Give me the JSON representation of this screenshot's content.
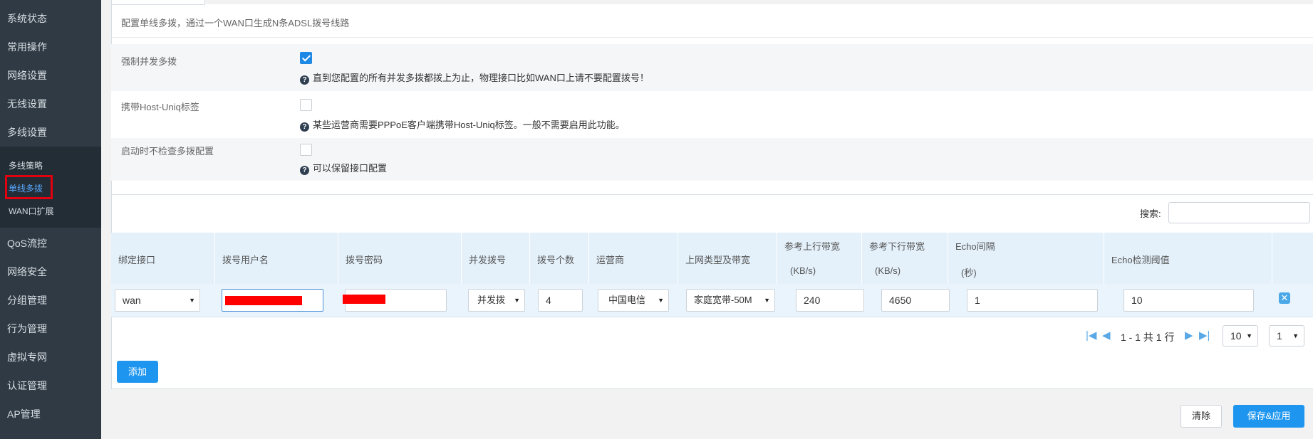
{
  "sidebar": {
    "items": [
      {
        "label": "系统状态"
      },
      {
        "label": "常用操作"
      },
      {
        "label": "网络设置"
      },
      {
        "label": "无线设置"
      },
      {
        "label": "多线设置"
      },
      {
        "label": "QoS流控"
      },
      {
        "label": "网络安全"
      },
      {
        "label": "分组管理"
      },
      {
        "label": "行为管理"
      },
      {
        "label": "虚拟专网"
      },
      {
        "label": "认证管理"
      },
      {
        "label": "AP管理"
      }
    ],
    "submenu": [
      {
        "label": "多线策略",
        "active": false
      },
      {
        "label": "单线多拨",
        "active": true
      },
      {
        "label": "WAN口扩展",
        "active": false
      }
    ]
  },
  "page": {
    "description": "配置单线多拨，通过一个WAN口生成N条ADSL拨号线路"
  },
  "options": [
    {
      "label": "强制并发多拨",
      "checked": true,
      "help": "直到您配置的所有并发多拨都拨上为止，物理接口比如WAN口上请不要配置拨号！"
    },
    {
      "label": "携带Host-Uniq标签",
      "checked": false,
      "help": "某些运营商需要PPPoE客户端携带Host-Uniq标签。一般不需要启用此功能。"
    },
    {
      "label": "启动时不检查多拨配置",
      "checked": false,
      "help": "可以保留接口配置"
    }
  ],
  "search": {
    "label": "搜索:",
    "value": ""
  },
  "table": {
    "headers": [
      {
        "l1": "绑定接口"
      },
      {
        "l1": "拨号用户名"
      },
      {
        "l1": "拨号密码"
      },
      {
        "l1": "并发拨号"
      },
      {
        "l1": "拨号个数"
      },
      {
        "l1": "运营商"
      },
      {
        "l1": "上网类型及带宽"
      },
      {
        "l1": "参考上行带宽",
        "l2": "(KB/s)"
      },
      {
        "l1": "参考下行带宽",
        "l2": "(KB/s)"
      },
      {
        "l1": "Echo间隔",
        "l2": "(秒)"
      },
      {
        "l1": "Echo检测阈值"
      }
    ],
    "row": {
      "interface": "wan",
      "concurrent": "并发拨",
      "count": "4",
      "isp": "中国电信",
      "type": "家庭宽带-50M",
      "up": "240",
      "down": "4650",
      "echo_interval": "1",
      "echo_threshold": "10"
    }
  },
  "pagination": {
    "info": "1 - 1 共 1 行",
    "page_size": "10",
    "page": "1"
  },
  "buttons": {
    "add": "添加",
    "clear": "清除",
    "save": "保存&应用"
  },
  "colors": {
    "sidebar_bg": "#2f3a45",
    "accent": "#1e96f0",
    "header_bg": "#e4f1fb",
    "redaction": "#ff0000"
  }
}
